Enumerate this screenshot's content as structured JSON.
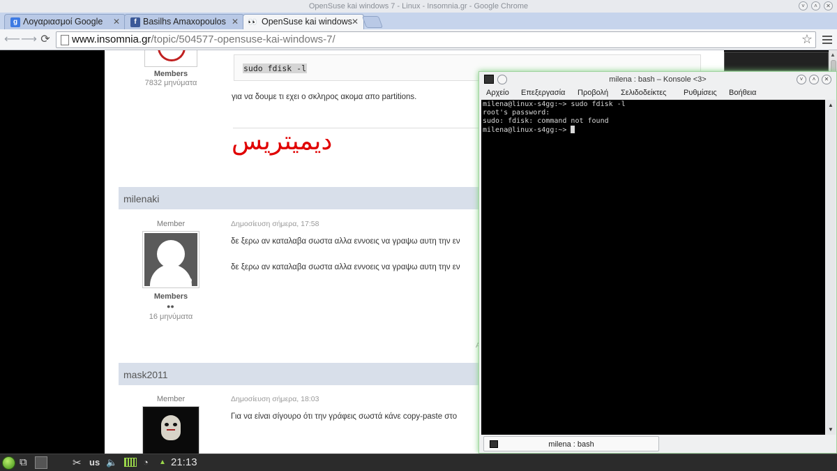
{
  "chrome": {
    "window_title": "OpenSuse kai windows 7 - Linux - Insomnia.gr - Google Chrome",
    "tabs": [
      {
        "label": "Λογαριασμοί Google",
        "favicon": "google-plus-icon"
      },
      {
        "label": "Basilhs Amaxopoulos",
        "favicon": "facebook-icon"
      },
      {
        "label": "OpenSuse kai windows",
        "favicon": "insomnia-eyes-icon"
      }
    ],
    "url_host": "www.insomnia.gr",
    "url_path": "/topic/504577-opensuse-kai-windows-7/"
  },
  "page": {
    "top_post": {
      "group": "Members",
      "post_count": "7832 μηνύματα",
      "code": "sudo fdisk -l",
      "text": "για να δουμε τι εχει ο σκληρος ακομα απο partitions.",
      "signature": "ديميتريس"
    },
    "post2": {
      "author": "milenaki",
      "role": "Member",
      "date": "Δημοσίευση σήμερα, 17:58",
      "line1": "δε ξερω αν καταλαβα σωστα αλλα εννοεις να γραψω αυτη την εν",
      "line2": "δε ξερω αν καταλαβα σωστα αλλα εννοεις να γραψω αυτη την εν",
      "group": "Members",
      "post_count": "16 μηνύματα",
      "fragment": "A"
    },
    "post3": {
      "author": "mask2011",
      "role": "Member",
      "date": "Δημοσίευση σήμερα, 18:03",
      "line1": "Για να είναι σίγουρο ότι την γράφεις σωστά κάνε copy-paste στο"
    }
  },
  "konsole": {
    "title": "milena : bash – Konsole <3>",
    "menus": [
      "Αρχείο",
      "Επεξεργασία",
      "Προβολή",
      "Σελιδοδείκτες",
      "Ρυθμίσεις",
      "Βοήθεια"
    ],
    "lines": [
      "milena@linux-s4gg:~> sudo fdisk -l",
      "root's password:",
      "sudo: fdisk: command not found"
    ],
    "prompt": "milena@linux-s4gg:~> ",
    "tab_label": "milena : bash"
  },
  "taskbar": {
    "keyboard_layout": "us",
    "clock": "21:13"
  },
  "colors": {
    "signature_red": "#e00000",
    "author_bar": "#d8dfea",
    "konsole_glow": "#7fcf7f"
  }
}
